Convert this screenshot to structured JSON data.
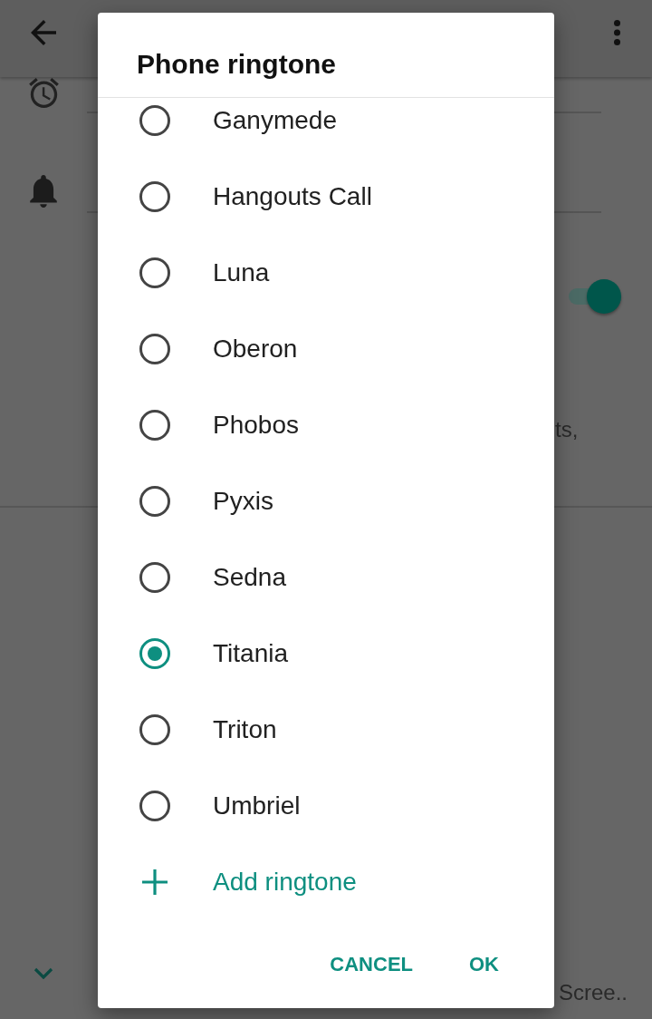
{
  "settings_background": {
    "toggle": {
      "on": true
    },
    "summary_fragment": "ts,",
    "bottom_item_fragment": "Scree.."
  },
  "dialog": {
    "title": "Phone ringtone",
    "options": [
      {
        "label": "Ganymede",
        "selected": false
      },
      {
        "label": "Hangouts Call",
        "selected": false
      },
      {
        "label": "Luna",
        "selected": false
      },
      {
        "label": "Oberon",
        "selected": false
      },
      {
        "label": "Phobos",
        "selected": false
      },
      {
        "label": "Pyxis",
        "selected": false
      },
      {
        "label": "Sedna",
        "selected": false
      },
      {
        "label": "Titania",
        "selected": true
      },
      {
        "label": "Triton",
        "selected": false
      },
      {
        "label": "Umbriel",
        "selected": false
      }
    ],
    "add_ringtone": {
      "label": "Add ringtone"
    },
    "buttons": [
      {
        "label": "CANCEL"
      },
      {
        "label": "OK"
      }
    ]
  }
}
